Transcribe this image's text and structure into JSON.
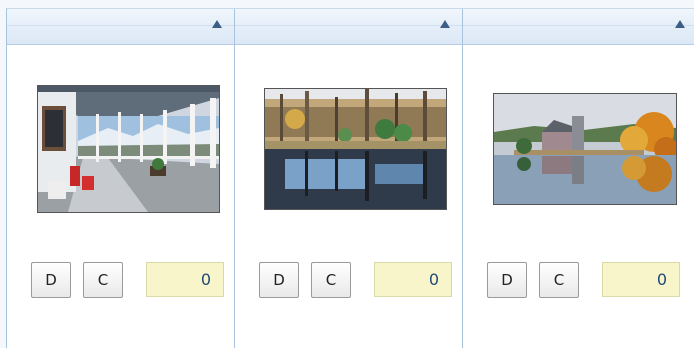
{
  "columns": [
    {
      "photo_icon": "porch-photo",
      "buttons": {
        "d_label": "D",
        "c_label": "C"
      },
      "count": "0"
    },
    {
      "photo_icon": "forest-pond-photo",
      "buttons": {
        "d_label": "D",
        "c_label": "C"
      },
      "count": "0"
    },
    {
      "photo_icon": "stone-chapel-photo",
      "buttons": {
        "d_label": "D",
        "c_label": "C"
      },
      "count": "0"
    }
  ],
  "colors": {
    "header_gradient": "#e5eef9",
    "border": "#a9c3dd",
    "counter_bg": "#f7f5c9",
    "counter_text": "#1f4a7a",
    "sort_arrow": "#3e5f85"
  }
}
